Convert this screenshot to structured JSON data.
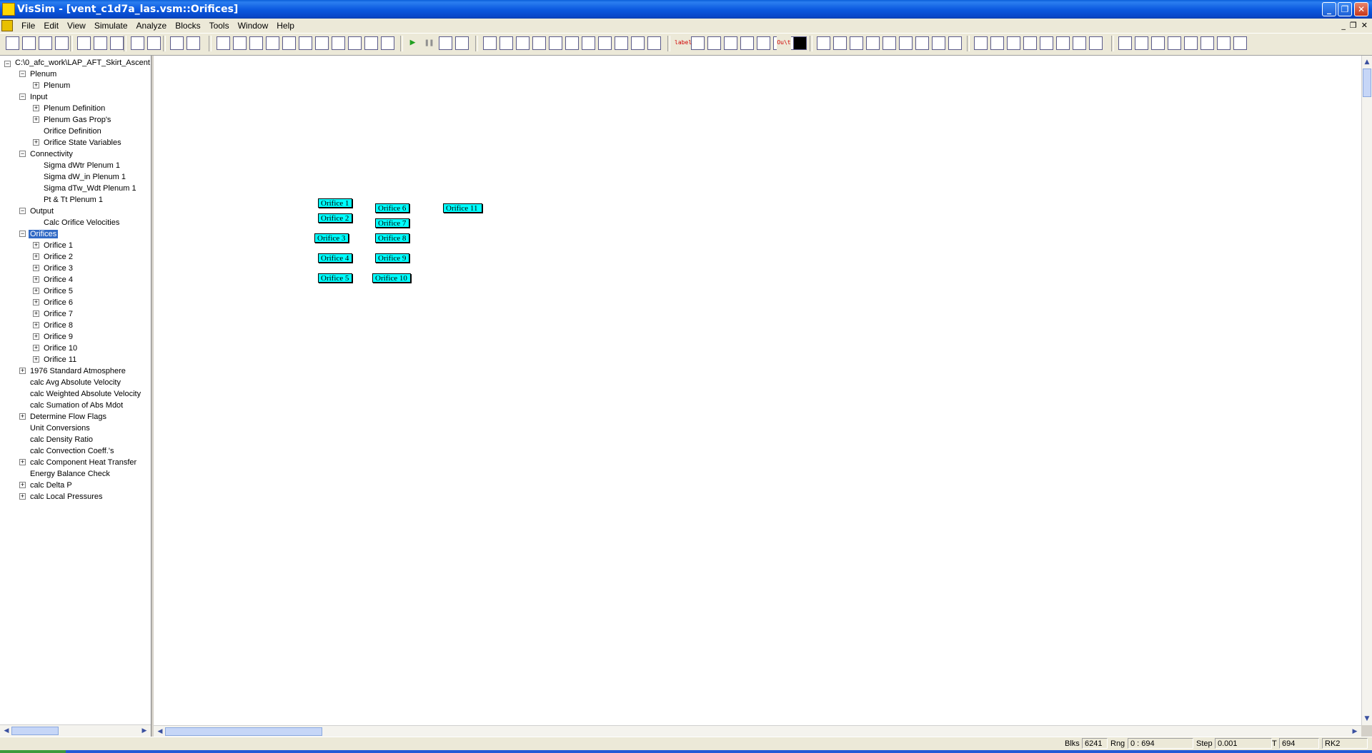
{
  "window": {
    "title": "VisSim - [vent_c1d7a_las.vsm::Orifices]",
    "controls": {
      "minimize": "_",
      "restore": "❐",
      "close": "✕"
    }
  },
  "menu": {
    "items": [
      "File",
      "Edit",
      "View",
      "Simulate",
      "Analyze",
      "Blocks",
      "Tools",
      "Window",
      "Help"
    ],
    "mdi_controls": {
      "minimize": "_",
      "restore": "❐",
      "close": "✕"
    }
  },
  "toolbar": {
    "label_button": "label",
    "out_button": "Ou\\t"
  },
  "tree": {
    "root": "C:\\0_afc_work\\LAP_AFT_Skirt_Ascent",
    "nodes": [
      {
        "label": "Plenum",
        "expander": "−"
      },
      {
        "label": "Plenum",
        "expander": "+"
      },
      {
        "label": "Input",
        "expander": "−"
      },
      {
        "label": "Plenum Definition",
        "expander": "+"
      },
      {
        "label": "Plenum Gas Prop's",
        "expander": "+"
      },
      {
        "label": "Orifice Definition",
        "expander": ""
      },
      {
        "label": "Orifice State Variables",
        "expander": "+"
      },
      {
        "label": "Connectivity",
        "expander": "−"
      },
      {
        "label": "Sigma dWtr Plenum 1",
        "expander": ""
      },
      {
        "label": "Sigma dW_in Plenum 1",
        "expander": ""
      },
      {
        "label": "Sigma dTw_Wdt Plenum 1",
        "expander": ""
      },
      {
        "label": "Pt & Tt Plenum 1",
        "expander": ""
      },
      {
        "label": "Output",
        "expander": "−"
      },
      {
        "label": "Calc Orifice Velocities",
        "expander": ""
      },
      {
        "label": "Orifices",
        "expander": "−"
      },
      {
        "label": "Orifice 1",
        "expander": "+"
      },
      {
        "label": "Orifice 2",
        "expander": "+"
      },
      {
        "label": "Orifice 3",
        "expander": "+"
      },
      {
        "label": "Orifice 4",
        "expander": "+"
      },
      {
        "label": "Orifice 5",
        "expander": "+"
      },
      {
        "label": "Orifice 6",
        "expander": "+"
      },
      {
        "label": "Orifice 7",
        "expander": "+"
      },
      {
        "label": "Orifice 8",
        "expander": "+"
      },
      {
        "label": "Orifice 9",
        "expander": "+"
      },
      {
        "label": "Orifice 10",
        "expander": "+"
      },
      {
        "label": "Orifice 11",
        "expander": "+"
      },
      {
        "label": "1976 Standard Atmosphere",
        "expander": "+"
      },
      {
        "label": "calc Avg Absolute Velocity",
        "expander": ""
      },
      {
        "label": "calc Weighted Absolute Velocity",
        "expander": ""
      },
      {
        "label": "calc Sumation of Abs Mdot",
        "expander": ""
      },
      {
        "label": "Determine Flow Flags",
        "expander": "+"
      },
      {
        "label": "Unit Conversions",
        "expander": ""
      },
      {
        "label": "calc Density Ratio",
        "expander": ""
      },
      {
        "label": "calc Convection Coeff.'s",
        "expander": ""
      },
      {
        "label": "calc Component Heat Transfer",
        "expander": "+"
      },
      {
        "label": "Energy Balance Check",
        "expander": ""
      },
      {
        "label": "calc Delta P",
        "expander": "+"
      },
      {
        "label": "calc Local Pressures",
        "expander": "+"
      }
    ],
    "selected": "Orifices"
  },
  "canvas": {
    "blocks": [
      "Orifice 1",
      "Orifice 2",
      "Orifice 3",
      "Orifice 4",
      "Orifice 5",
      "Orifice 6",
      "Orifice 7",
      "Orifice 8",
      "Orifice 9",
      "Orifice 10",
      "Orifice 11"
    ],
    "block_color": "#00ffff"
  },
  "status": {
    "blks_label": "Blks",
    "blks_value": "6241",
    "rng_label": "Rng",
    "rng_value": "0 : 694",
    "step_label": "Step",
    "step_value": "0.001",
    "t_label": "T",
    "t_value": "694",
    "integrator": "RK2"
  }
}
